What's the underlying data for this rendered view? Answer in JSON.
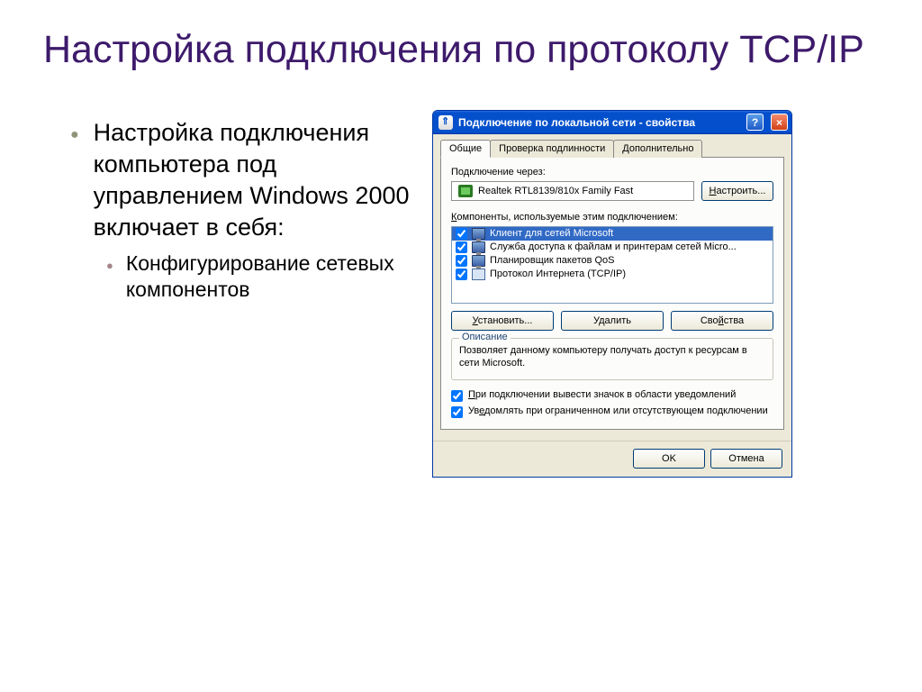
{
  "slide": {
    "title": "Настройка подключения по протоколу TCP/IP",
    "bullet1": "Настройка подключения компьютера под управлением Windows 2000 включает в себя:",
    "bullet2": "Конфигурирование сетевых компонентов"
  },
  "dialog": {
    "title": "Подключение по локальной сети - свойства",
    "tabs": {
      "general": "Общие",
      "auth": "Проверка подлинности",
      "advanced": "Дополнительно"
    },
    "connect_via_label": "Подключение через:",
    "adapter": "Realtek RTL8139/810x Family Fast",
    "configure_btn": "Настроить...",
    "components_label": "Компоненты, используемые этим подключением:",
    "components": [
      {
        "label": "Клиент для сетей Microsoft",
        "selected": true,
        "checked": true
      },
      {
        "label": "Служба доступа к файлам и принтерам сетей Micro...",
        "selected": false,
        "checked": true
      },
      {
        "label": "Планировщик пакетов QoS",
        "selected": false,
        "checked": true
      },
      {
        "label": "Протокол Интернета (TCP/IP)",
        "selected": false,
        "checked": true
      }
    ],
    "install_btn": "Установить...",
    "remove_btn": "Удалить",
    "props_btn": "Свойства",
    "desc_legend": "Описание",
    "desc_text": "Позволяет данному компьютеру получать доступ к ресурсам в сети Microsoft.",
    "chk1": "При подключении вывести значок в области уведомлений",
    "chk2": "Уведомлять при ограниченном или отсутствующем подключении",
    "ok": "OK",
    "cancel": "Отмена"
  }
}
